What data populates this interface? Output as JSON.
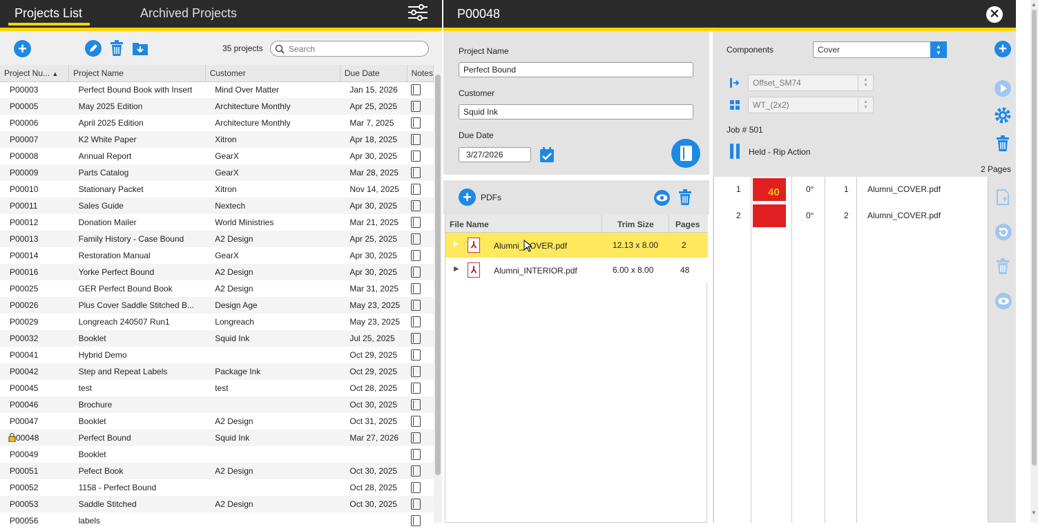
{
  "left": {
    "tabs": [
      "Projects List",
      "Archived Projects"
    ],
    "project_count": "35 projects",
    "search_placeholder": "Search",
    "columns": [
      "Project Nu...",
      "Project Name",
      "Customer",
      "Due Date",
      "Notes"
    ],
    "rows": [
      [
        "P00003",
        "Perfect Bound Book with Insert",
        "Mind Over Matter",
        "Jan 15, 2026"
      ],
      [
        "P00005",
        "May 2025 Edition",
        "Architecture Monthly",
        "Apr 25, 2025"
      ],
      [
        "P00006",
        "April 2025 Edition",
        "Architecture Monthly",
        "Mar 7, 2025"
      ],
      [
        "P00007",
        "K2 White Paper",
        "Xitron",
        "Apr 18, 2025"
      ],
      [
        "P00008",
        "Annual Report",
        "GearX",
        "Apr 30, 2025"
      ],
      [
        "P00009",
        "Parts Catalog",
        "GearX",
        "Mar 28, 2025"
      ],
      [
        "P00010",
        "Stationary Packet",
        "Xitron",
        "Nov 14, 2025"
      ],
      [
        "P00011",
        "Sales Guide",
        "Nextech",
        "Apr 30, 2025"
      ],
      [
        "P00012",
        "Donation Mailer",
        "World Ministries",
        "Mar 21, 2025"
      ],
      [
        "P00013",
        "Family History - Case Bound",
        "A2 Design",
        "Apr 25, 2025"
      ],
      [
        "P00014",
        "Restoration Manual",
        "GearX",
        "Apr 30, 2025"
      ],
      [
        "P00016",
        "Yorke Perfect Bound",
        "A2 Design",
        "Apr 30, 2025"
      ],
      [
        "P00025",
        "GER Perfect Bound Book",
        "A2 Design",
        "Mar 31, 2025"
      ],
      [
        "P00026",
        "Plus Cover Saddle Stitched B...",
        "Design Age",
        "May 23, 2025"
      ],
      [
        "P00029",
        "Longreach 240507 Run1",
        "Longreach",
        "May 23, 2025"
      ],
      [
        "P00032",
        "Booklet",
        "Squid Ink",
        "Jul 25, 2025"
      ],
      [
        "P00041",
        "Hybrid Demo",
        "",
        "Oct 29, 2025"
      ],
      [
        "P00042",
        "Step and Repeat Labels",
        "Package Ink",
        "Oct 29, 2025"
      ],
      [
        "P00045",
        "test",
        "test",
        "Oct 28, 2025"
      ],
      [
        "P00046",
        "Brochure",
        "",
        "Oct 30, 2025"
      ],
      [
        "P00047",
        "Booklet",
        "A2 Design",
        "Oct 31, 2025"
      ],
      [
        "00048",
        "Perfect Bound",
        "Squid Ink",
        "Mar 27, 2026"
      ],
      [
        "P00049",
        "Booklet",
        "",
        ""
      ],
      [
        "P00051",
        "Pefect Book",
        "A2 Design",
        "Oct 30, 2025"
      ],
      [
        "P00052",
        "1158 - Perfect Bound",
        "",
        "Oct 28, 2025"
      ],
      [
        "P00053",
        "Saddle Stitched",
        "A2 Design",
        "Oct 30, 2025"
      ],
      [
        "P00056",
        "labels",
        "",
        ""
      ]
    ]
  },
  "detail": {
    "title": "P00048",
    "project_name_label": "Project Name",
    "project_name": "Perfect Bound",
    "customer_label": "Customer",
    "customer": "Squid Ink",
    "due_date_label": "Due Date",
    "due_date": "3/27/2026",
    "pdfs_label": "PDFs",
    "pdf_columns": [
      "File Name",
      "Trim Size",
      "Pages"
    ],
    "pdfs": [
      {
        "name": "Alumni_COVER.pdf",
        "trim": "12.13 x 8.00",
        "pages": "2"
      },
      {
        "name": "Alumni_INTERIOR.pdf",
        "trim": "6.00 x 8.00",
        "pages": "48"
      }
    ]
  },
  "components": {
    "label": "Components",
    "selected": "Cover",
    "device": "Offset_SM74",
    "layout": "WT_(2x2)",
    "job": "Job # 501",
    "status": "Held - Rip Action",
    "page_count": "2 Pages",
    "pages": [
      {
        "num": "1",
        "rot": "0°",
        "src_page": "1",
        "file": "Alumni_COVER.pdf"
      },
      {
        "num": "2",
        "rot": "0°",
        "src_page": "2",
        "file": "Alumni_COVER.pdf"
      }
    ]
  },
  "colors": {
    "accent": "#ffd400",
    "primary": "#1e88e5",
    "header": "#2b2b2b",
    "selected_row": "#ffe85c"
  }
}
